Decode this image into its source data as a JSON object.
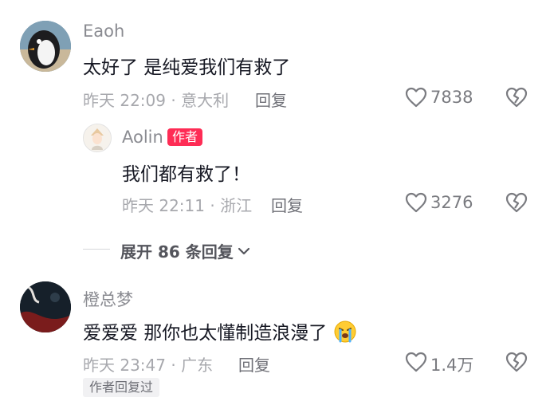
{
  "comments": [
    {
      "username": "Eaoh",
      "text": "太好了 是纯爱我们有救了",
      "meta": "昨天 22:09 · 意大利",
      "reply_label": "回复",
      "likes": "7838",
      "reply": {
        "username": "Aolin",
        "author_tag": "作者",
        "text": "我们都有救了！",
        "meta": "昨天 22:11 · 浙江",
        "reply_label": "回复",
        "likes": "3276"
      },
      "expand_label": "展开 86 条回复"
    },
    {
      "username": "橙总梦",
      "text": "爱爱爱 那你也太懂制造浪漫了",
      "emoji": "loudly-crying-face",
      "meta": "昨天 23:47 · 广东",
      "reply_label": "回复",
      "likes": "1.4万",
      "author_replied": "作者回复过"
    }
  ],
  "colors": {
    "author_tag": "#fe2c55",
    "username": "#8a8b91",
    "meta": "#a7a8ad"
  }
}
